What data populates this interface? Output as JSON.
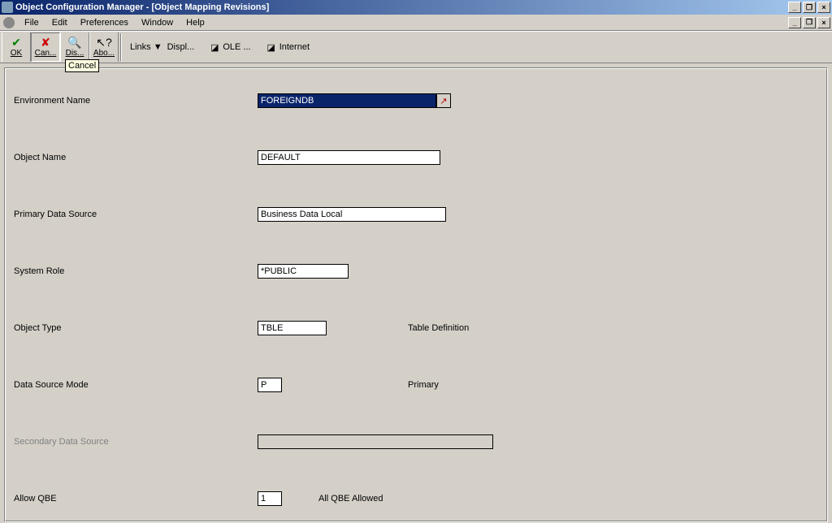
{
  "title": "Object Configuration Manager - [Object Mapping Revisions]",
  "menu": [
    "File",
    "Edit",
    "Preferences",
    "Window",
    "Help"
  ],
  "toolbar": {
    "ok": "OK",
    "cancel": "Can...",
    "dispatch": "Dis...",
    "about": "Abo...",
    "tooltip": "Cancel",
    "links": "Links",
    "displ": "Displ...",
    "ole": "OLE ...",
    "internet": "Internet"
  },
  "form": {
    "env_lbl": "Environment Name",
    "env_val": "FOREIGNDB",
    "obj_lbl": "Object Name",
    "obj_val": "DEFAULT",
    "pds_lbl": "Primary Data Source",
    "pds_val": "Business Data Local",
    "role_lbl": "System Role",
    "role_val": "*PUBLIC",
    "type_lbl": "Object Type",
    "type_val": "TBLE",
    "type_desc": "Table Definition",
    "mode_lbl": "Data Source Mode",
    "mode_val": "P",
    "mode_desc": "Primary",
    "sds_lbl": "Secondary Data Source",
    "sds_val": "",
    "qbe_lbl": "Allow QBE",
    "qbe_val": "1",
    "qbe_desc": "All QBE Allowed"
  }
}
